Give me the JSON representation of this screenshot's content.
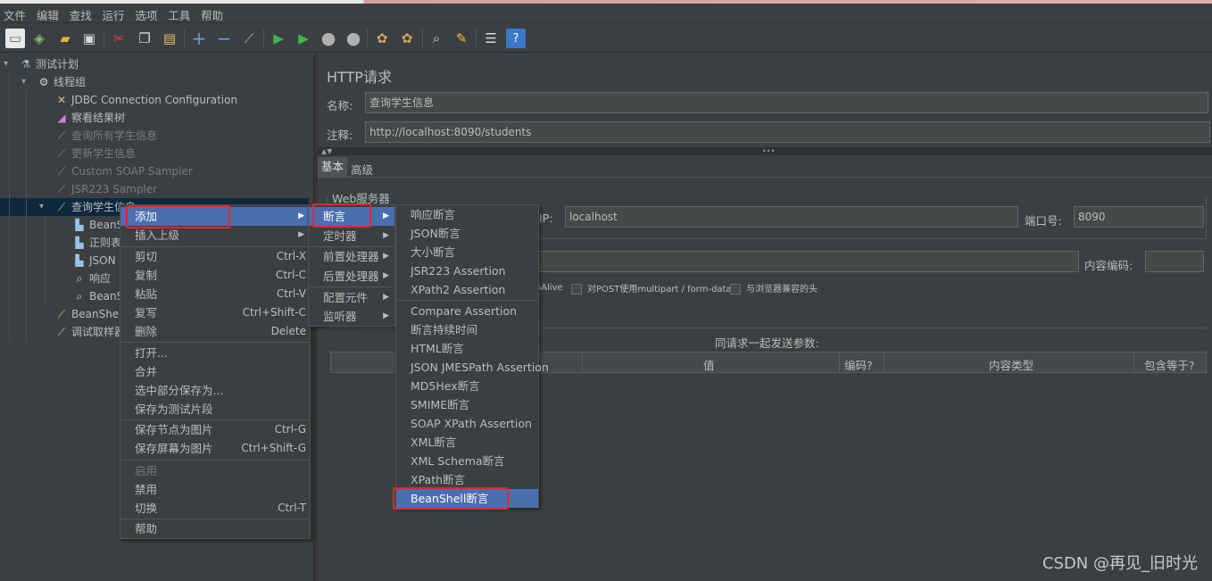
{
  "menubar": [
    "文件",
    "编辑",
    "查找",
    "运行",
    "选项",
    "工具",
    "帮助"
  ],
  "tree": {
    "test_plan": "测试计划",
    "thread_group": "线程组",
    "jdbc": "JDBC Connection Configuration",
    "view_results": "察看结果树",
    "query_all": "查询所有学生信息",
    "update": "更新学生信息",
    "custom_soap": "Custom SOAP Sampler",
    "jsr223": "JSR223 Sampler",
    "query_student": "查询学生信息",
    "child1": "BeanS",
    "child2": "正则表",
    "child3": "JSON",
    "child4": "响应",
    "child5": "BeanS",
    "beanshell": "BeanShell",
    "debug": "调试取样器"
  },
  "right": {
    "title": "HTTP请求",
    "name_label": "名称:",
    "name_value": "查询学生信息",
    "comment_label": "注释:",
    "comment_value": "http://localhost:8090/students",
    "tab_basic": "基本",
    "tab_advanced": "高级",
    "web_server": "Web服务器",
    "ip_label": "IP:",
    "ip_value": "localhost",
    "port_label": "端口号:",
    "port_value": "8090",
    "encoding_label": "内容编码:",
    "keepalive": "oAlive",
    "multipart": "对POST使用multipart / form-data",
    "browser_headers": "与浏览器兼容的头",
    "params_title": "同请求一起发送参数:",
    "col_value": "值",
    "col_encode": "编码?",
    "col_ctype": "内容类型",
    "col_include": "包含等于?"
  },
  "ctx1": [
    {
      "label": "添加",
      "sub": true
    },
    {
      "label": "插入上级",
      "sub": true
    },
    {
      "label": "剪切",
      "shortcut": "Ctrl-X"
    },
    {
      "label": "复制",
      "shortcut": "Ctrl-C"
    },
    {
      "label": "粘贴",
      "shortcut": "Ctrl-V"
    },
    {
      "label": "复写",
      "shortcut": "Ctrl+Shift-C"
    },
    {
      "label": "删除",
      "shortcut": "Delete"
    },
    {
      "label": "打开..."
    },
    {
      "label": "合并"
    },
    {
      "label": "选中部分保存为..."
    },
    {
      "label": "保存为测试片段"
    },
    {
      "label": "保存节点为图片",
      "shortcut": "Ctrl-G"
    },
    {
      "label": "保存屏幕为图片",
      "shortcut": "Ctrl+Shift-G"
    },
    {
      "label": "启用"
    },
    {
      "label": "禁用"
    },
    {
      "label": "切换",
      "shortcut": "Ctrl-T"
    },
    {
      "label": "帮助"
    }
  ],
  "ctx2": [
    "断言",
    "定时器",
    "前置处理器",
    "后置处理器",
    "配置元件",
    "监听器"
  ],
  "ctx3": [
    "响应断言",
    "JSON断言",
    "大小断言",
    "JSR223 Assertion",
    "XPath2 Assertion",
    "Compare Assertion",
    "断言持续时间",
    "HTML断言",
    "JSON JMESPath Assertion",
    "MD5Hex断言",
    "SMIME断言",
    "SOAP XPath Assertion",
    "XML断言",
    "XML Schema断言",
    "XPath断言",
    "BeanShell断言"
  ],
  "watermark": "CSDN @再见_旧时光",
  "colors": {
    "bg": "#3c3f41",
    "highlight": "#4b6eaf",
    "selected_row": "#0d293e",
    "red_box": "#e0282a"
  }
}
